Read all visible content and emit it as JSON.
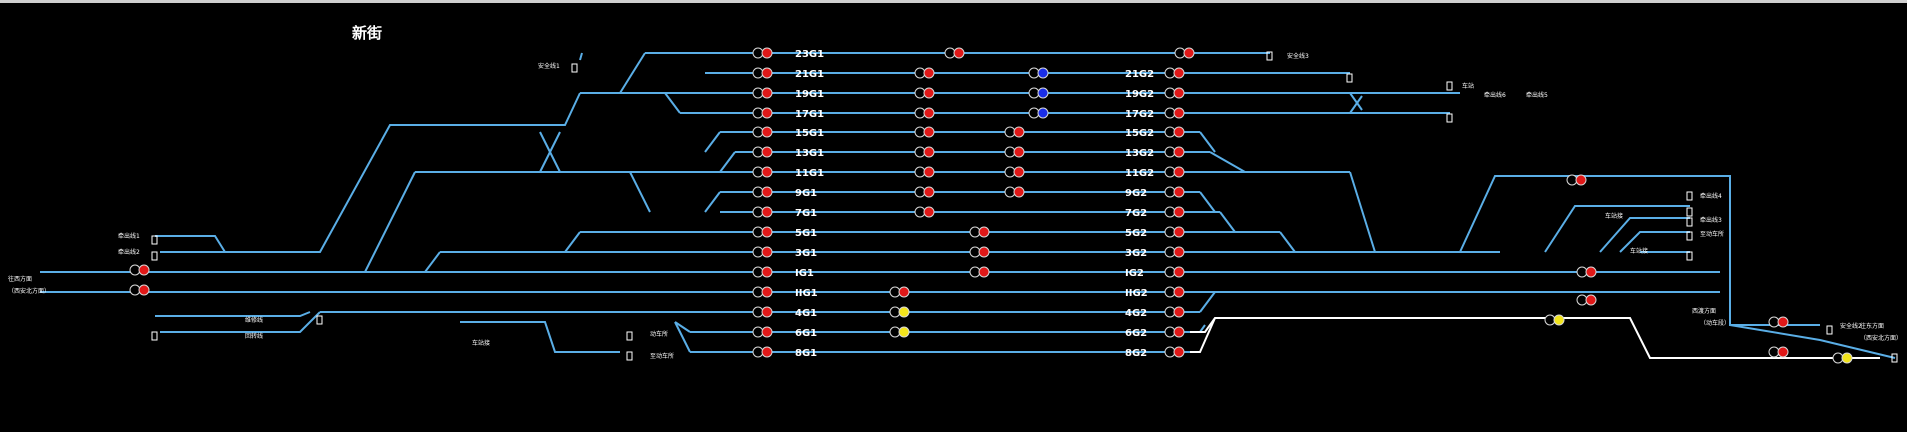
{
  "station": {
    "name": "新街"
  },
  "colors": {
    "track": "#5aaee6",
    "route": "#ffffff",
    "red": "#e01818",
    "blue": "#1a2ee8",
    "yellow": "#f2e41c",
    "lamp_off": "#000000",
    "lamp_ring": "#d8d8d8"
  },
  "tracks_left": [
    "23G1",
    "21G1",
    "19G1",
    "17G1",
    "15G1",
    "13G1",
    "11G1",
    "9G1",
    "7G1",
    "5G1",
    "3G1",
    "IG1",
    "IIG1",
    "4G1",
    "6G1",
    "8G1"
  ],
  "tracks_right": [
    "21G2",
    "19G2",
    "17G2",
    "15G2",
    "13G2",
    "11G2",
    "9G2",
    "7G2",
    "5G2",
    "3G2",
    "IG2",
    "IIG2",
    "4G2",
    "6G2",
    "8G2"
  ],
  "side_labels": {
    "safe1": "安全线1",
    "safe3": "安全线3",
    "safe2": "安全线2",
    "pull1": "牵出线1",
    "pull2": "牵出线2",
    "pull4": "牵出线4",
    "pull5": "牵出线5",
    "pull6": "牵出线6",
    "pull3": "牵出线3",
    "dir_left": "往西方面",
    "dir_left_sub": "（西安北方面）",
    "dir_right": "往东方面",
    "dir_right_sub": "（西安北方面）",
    "junction": "西渡方面",
    "junction_sub": "（动车段）",
    "yard": "车站",
    "repair": "维修线",
    "depot": "动车所",
    "loop": "回转线",
    "to_depot": "至动车所",
    "gate": "车站接"
  },
  "signals": {
    "left_column": [
      "red",
      "red",
      "red",
      "red",
      "red",
      "red",
      "red",
      "red",
      "red",
      "red",
      "red",
      "red",
      "red",
      "red",
      "red",
      "red"
    ],
    "mid_left": [
      "red",
      "red",
      "red",
      "red",
      "red",
      "red",
      "red",
      "red",
      "red",
      "red",
      "red",
      "red",
      "red",
      "yellow",
      "yellow"
    ],
    "mid_blue": [
      "blue",
      "blue",
      "blue"
    ],
    "right_column": [
      "red",
      "red",
      "red",
      "red",
      "red",
      "red",
      "red",
      "red",
      "red",
      "red",
      "red",
      "red",
      "red",
      "red",
      "red"
    ],
    "far_right_yellow": [
      "yellow",
      "yellow",
      "yellow"
    ]
  }
}
